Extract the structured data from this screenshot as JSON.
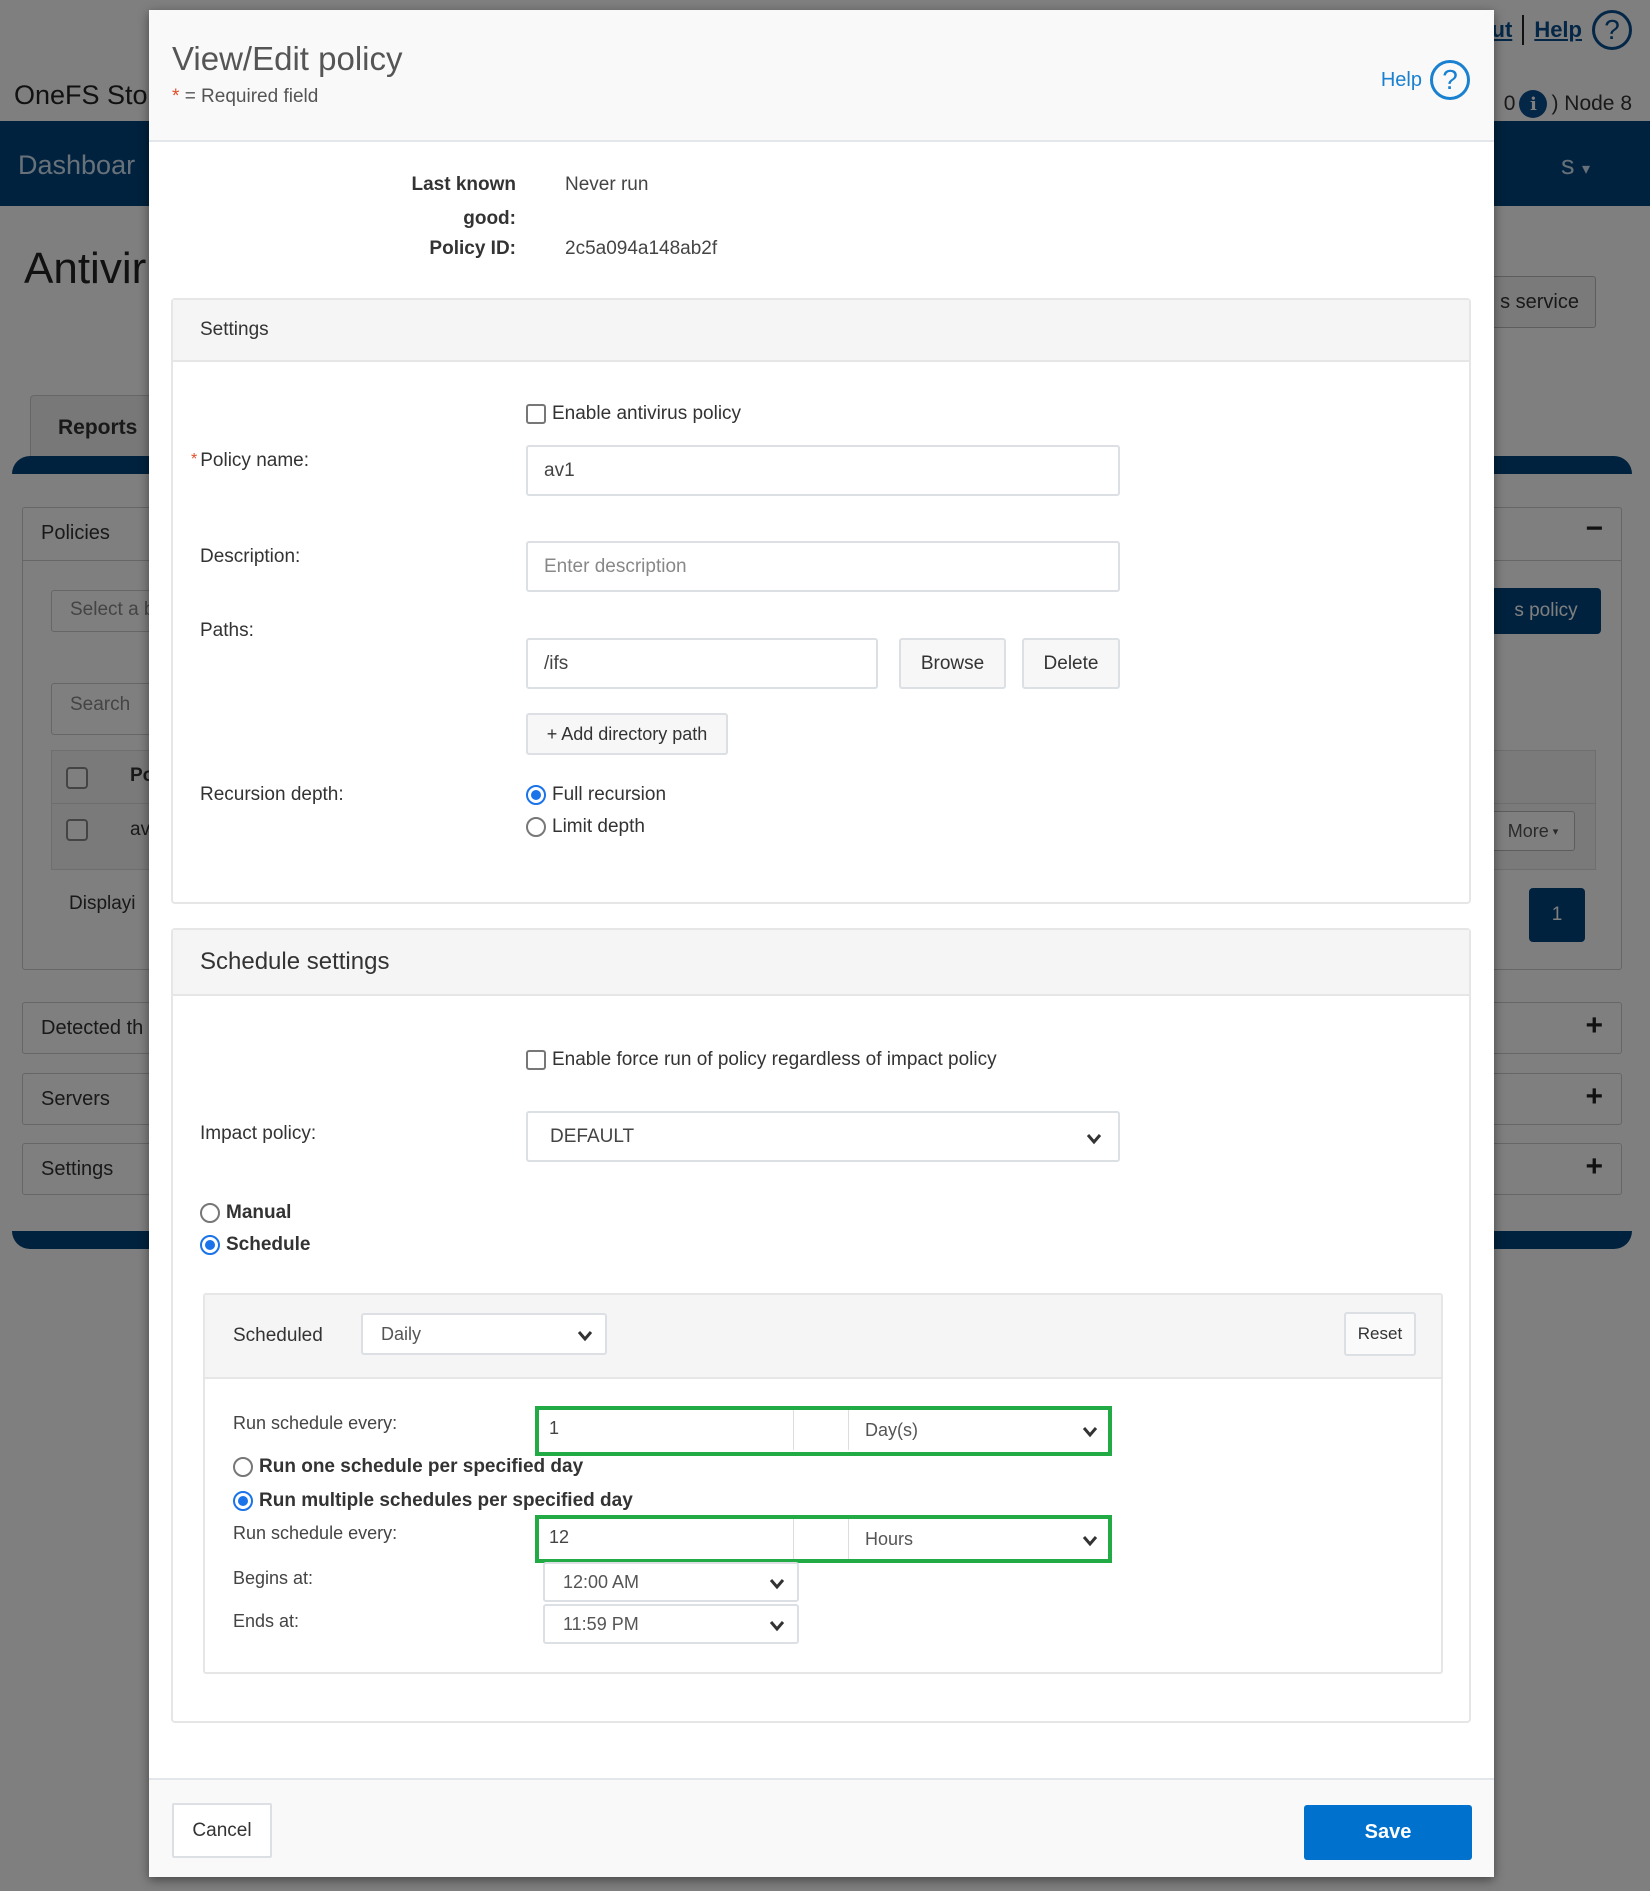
{
  "background": {
    "app_title": "OneFS Sto",
    "top_links": {
      "logout_partial": "ut",
      "help": "Help"
    },
    "node_info": {
      "version_partial": "0",
      "node": ") Node 8"
    },
    "nav": {
      "left_item": "Dashboar",
      "right_item": "s"
    },
    "page_title": "Antivir",
    "service_button": "s service",
    "tab_reports": "Reports",
    "policies_panel": {
      "title": "Policies",
      "select_placeholder": "Select a b",
      "add_policy_button": "s policy",
      "search_placeholder": "Search",
      "column_partial": "Po",
      "row_partial": "av",
      "more_button": "More",
      "displaying_partial": "Displayi",
      "page_number": "1"
    },
    "collapsed_panels": [
      "Detected th",
      "Servers",
      "Settings"
    ]
  },
  "modal": {
    "title": "View/Edit policy",
    "required_note": "= Required field",
    "required_star": "*",
    "help_label": "Help",
    "info": {
      "last_known_good_label_1": "Last known",
      "last_known_good_label_2": "good:",
      "last_known_good_value": "Never run",
      "policy_id_label": "Policy ID:",
      "policy_id_value": "2c5a094a148ab2f"
    },
    "settings": {
      "title": "Settings",
      "enable_label": "Enable antivirus policy",
      "enable_checked": false,
      "policy_name_label": "Policy name:",
      "policy_name_value": "av1",
      "description_label": "Description:",
      "description_placeholder": "Enter description",
      "paths_label": "Paths:",
      "path_value": "/ifs",
      "browse_button": "Browse",
      "delete_button": "Delete",
      "add_path_button": "+ Add directory path",
      "recursion_label": "Recursion depth:",
      "recursion_options": [
        "Full recursion",
        "Limit depth"
      ],
      "recursion_selected": "Full recursion"
    },
    "schedule": {
      "title": "Schedule settings",
      "force_run_label": "Enable force run of policy regardless of impact policy",
      "force_run_checked": false,
      "impact_policy_label": "Impact policy:",
      "impact_policy_value": "DEFAULT",
      "mode_options": [
        "Manual",
        "Schedule"
      ],
      "mode_selected": "Schedule",
      "sub": {
        "scheduled_label": "Scheduled",
        "scheduled_value": "Daily",
        "reset_button": "Reset",
        "run_every_label": "Run schedule every:",
        "run_every_value": "1",
        "run_every_unit": "Day(s)",
        "per_day_options": [
          "Run one schedule per specified day",
          "Run multiple schedules per specified day"
        ],
        "per_day_selected": "Run multiple schedules per specified day",
        "run_every_label_2": "Run schedule every:",
        "run_every_value_2": "12",
        "run_every_unit_2": "Hours",
        "begins_label": "Begins at:",
        "begins_value": "12:00 AM",
        "ends_label": "Ends at:",
        "ends_value": "11:59 PM"
      }
    },
    "footer": {
      "cancel": "Cancel",
      "save": "Save"
    }
  },
  "colors": {
    "primary": "#0072ce",
    "nav_blue": "#00447c",
    "highlight_green": "#22aa44",
    "required_red": "#e0502a"
  }
}
